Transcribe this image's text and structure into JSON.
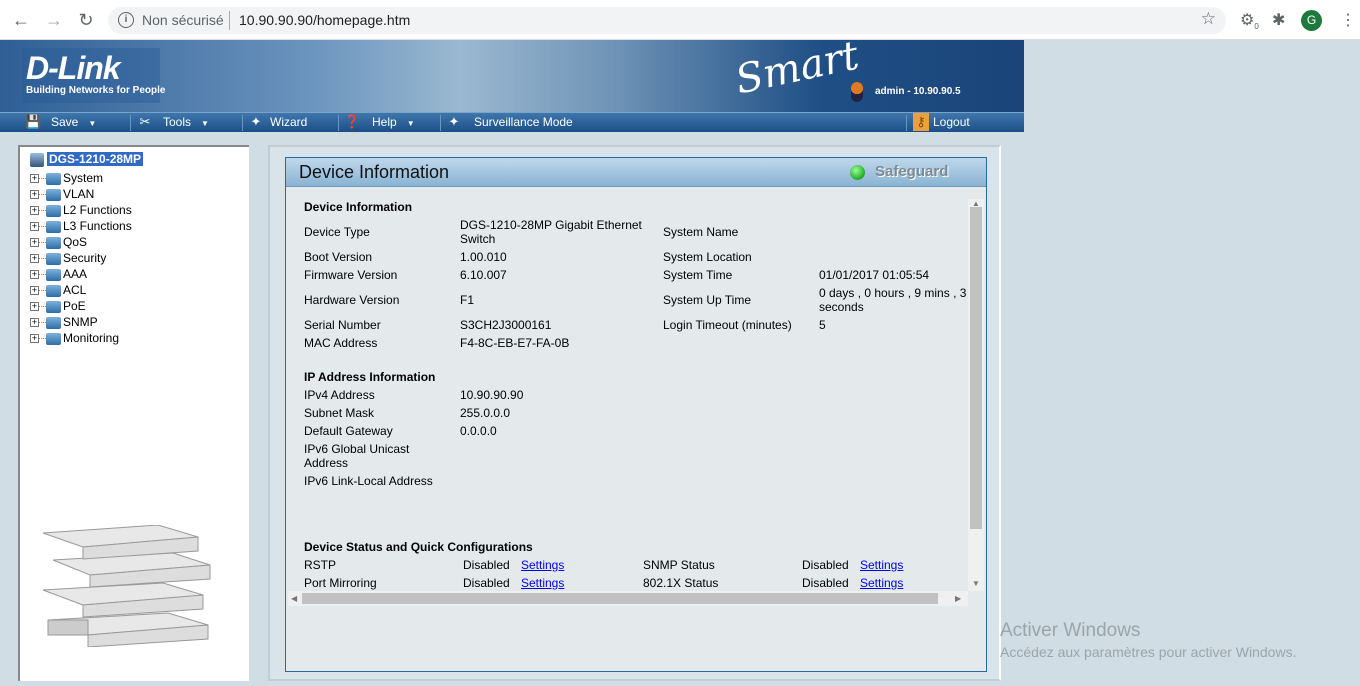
{
  "browser": {
    "security_label": "Non sécurisé",
    "url": "10.90.90.90/homepage.htm",
    "profile_initial": "G",
    "extension_badge": "0"
  },
  "header": {
    "brand": "D-Link",
    "tagline": "Building Networks for People",
    "product_logo": "Smart",
    "user_info": "admin - 10.90.90.5"
  },
  "menu": {
    "save": "Save",
    "tools": "Tools",
    "wizard": "Wizard",
    "help": "Help",
    "surveillance": "Surveillance Mode",
    "logout": "Logout"
  },
  "tree": {
    "root": "DGS-1210-28MP",
    "items": [
      "System",
      "VLAN",
      "L2 Functions",
      "L3 Functions",
      "QoS",
      "Security",
      "AAA",
      "ACL",
      "PoE",
      "SNMP",
      "Monitoring"
    ]
  },
  "panel": {
    "title": "Device Information",
    "safeguard": "Safeguard",
    "safeguard_color": "#33bb33"
  },
  "device_info": {
    "heading": "Device Information",
    "rows": [
      {
        "l1": "Device Type",
        "v1a": "DGS-1210-28MP Gigabit Ethernet",
        "v1b": "Switch",
        "l2": "System Name",
        "v2a": "",
        "v2b": ""
      },
      {
        "l1": "Boot Version",
        "v1a": "1.00.010",
        "v1b": "",
        "l2": "System Location",
        "v2a": "",
        "v2b": ""
      },
      {
        "l1": "Firmware Version",
        "v1a": "6.10.007",
        "v1b": "",
        "l2": "System Time",
        "v2a": "01/01/2017 01:05:54",
        "v2b": ""
      },
      {
        "l1": "Hardware Version",
        "v1a": "F1",
        "v1b": "",
        "l2": "System Up Time",
        "v2a": "0 days , 0 hours , 9 mins , 3",
        "v2b": "seconds"
      },
      {
        "l1": "Serial Number",
        "v1a": "S3CH2J3000161",
        "v1b": "",
        "l2": "Login Timeout (minutes)",
        "v2a": "5",
        "v2b": ""
      },
      {
        "l1": "MAC Address",
        "v1a": "F4-8C-EB-E7-FA-0B",
        "v1b": "",
        "l2": "",
        "v2a": "",
        "v2b": ""
      }
    ]
  },
  "ip_info": {
    "heading": "IP Address Information",
    "rows": [
      {
        "label": "IPv4 Address",
        "value": "10.90.90.90"
      },
      {
        "label": "Subnet Mask",
        "value": "255.0.0.0"
      },
      {
        "label": "Default Gateway",
        "value": "0.0.0.0"
      },
      {
        "label": "IPv6 Global Unicast",
        "label2": "Address",
        "value": ""
      },
      {
        "label": "IPv6 Link-Local Address",
        "value": ""
      }
    ]
  },
  "status": {
    "heading": "Device Status and Quick Configurations",
    "rows": [
      {
        "l1": "RSTP",
        "s1": "Disabled",
        "a1": "Settings",
        "l2": "SNMP Status",
        "s2": "Disabled",
        "a2": "Settings"
      },
      {
        "l1": "Port Mirroring",
        "s1": "Disabled",
        "a1": "Settings",
        "l2": "802.1X Status",
        "s2": "Disabled",
        "a2": "Settings"
      }
    ]
  },
  "watermark": {
    "line1": "Activer Windows",
    "line2": "Accédez aux paramètres pour activer Windows."
  }
}
